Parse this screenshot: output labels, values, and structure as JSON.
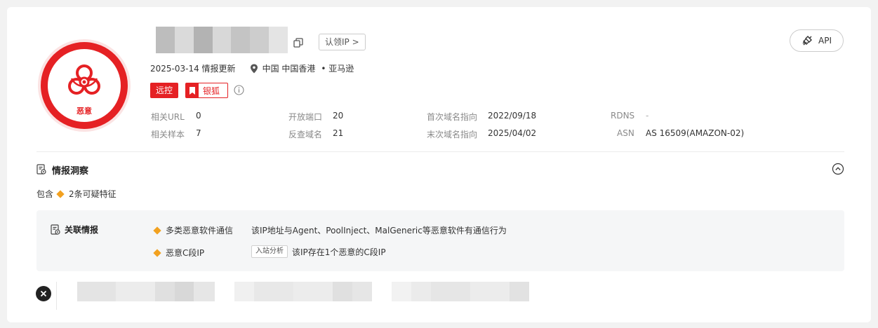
{
  "badge": {
    "label": "恶意",
    "icon": "biohazard-icon",
    "color": "#e52124"
  },
  "header": {
    "ip_blur_shades": [
      "#bdbdbd",
      "#dadada",
      "#b3b3b3",
      "#d8d8d8",
      "#c4c4c4",
      "#cdcdcd",
      "#e4e4e4"
    ],
    "claim_label": "认领IP >",
    "api_label": "API"
  },
  "meta": {
    "date_text": "2025-03-14 情报更新",
    "location": "中国 中国香港",
    "provider": "• 亚马逊"
  },
  "tags": {
    "remote_control": "远控",
    "silver_fox": "银狐"
  },
  "details": {
    "related_url_key": "相关URL",
    "related_url_val": "0",
    "related_sample_key": "相关样本",
    "related_sample_val": "7",
    "open_port_key": "开放端口",
    "open_port_val": "20",
    "reverse_domain_key": "反查域名",
    "reverse_domain_val": "21",
    "first_domain_key": "首次域名指向",
    "first_domain_val": "2022/09/18",
    "last_domain_key": "末次域名指向",
    "last_domain_val": "2025/04/02",
    "rdns_key": "RDNS",
    "rdns_val": "-",
    "asn_key": "ASN",
    "asn_val": "AS 16509(AMAZON-02)"
  },
  "insight": {
    "title": "情报洞察",
    "contains_prefix": "包含",
    "contains_count": "2条可疑特征"
  },
  "related": {
    "title": "关联情报",
    "items": [
      {
        "name": "多类恶意软件通信",
        "desc": "该IP地址与Agent、PoolInject、MalGeneric等恶意软件有通信行为",
        "tag": ""
      },
      {
        "name": "恶意C段IP",
        "desc": "该IP存在1个恶意的C段IP",
        "tag": "入站分析"
      }
    ]
  },
  "colors": {
    "accent_red": "#e52124",
    "diamond_orange": "#f2a120",
    "panel_bg": "#f5f6f7"
  }
}
